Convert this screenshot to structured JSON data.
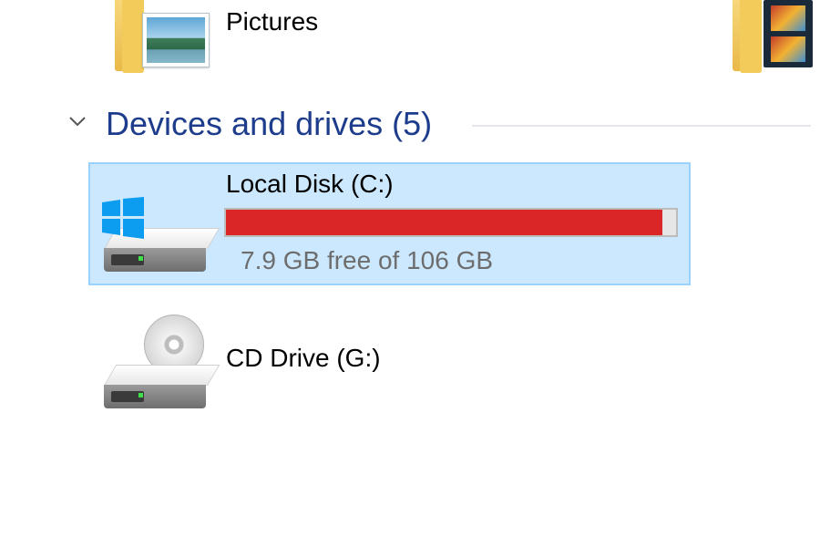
{
  "folders": [
    {
      "label": "Pictures",
      "icon": "pictures-folder-icon"
    },
    {
      "label": "",
      "icon": "videos-folder-icon"
    }
  ],
  "section": {
    "title": "Devices and drives (5)",
    "expanded": true
  },
  "drives": [
    {
      "name": "Local Disk (C:)",
      "free_text": "7.9 GB free of 106 GB",
      "used_fraction": 0.97,
      "bar_color": "#da2626",
      "selected": true,
      "icon": "windows-hard-drive-icon"
    },
    {
      "name": "CD Drive (G:)",
      "icon": "cd-drive-icon"
    }
  ],
  "colors": {
    "selection_bg": "#cce8ff",
    "selection_border": "#99d1ff",
    "section_title": "#1e3c8c",
    "usage_critical": "#da2626"
  }
}
